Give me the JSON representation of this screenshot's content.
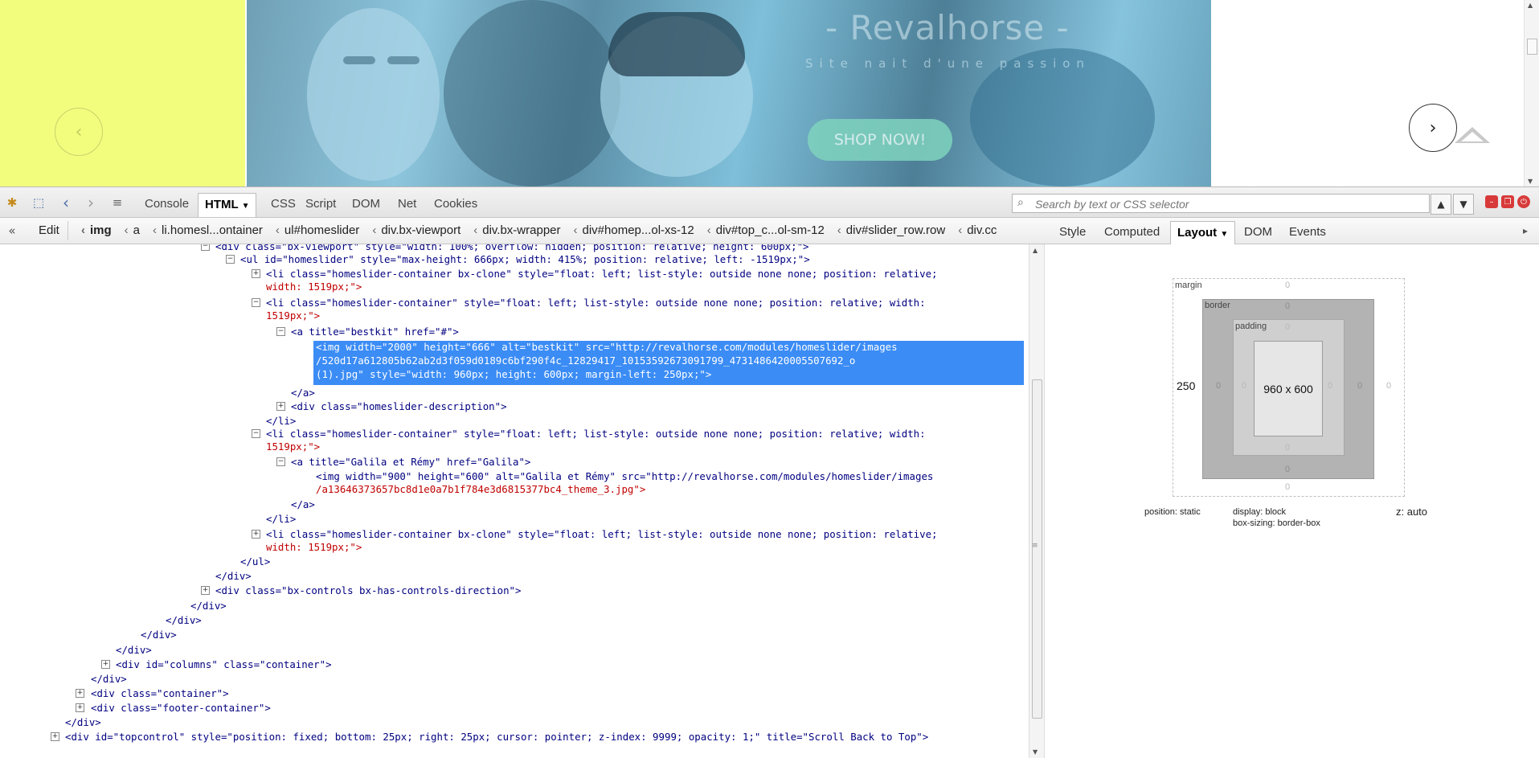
{
  "page": {
    "hero": {
      "title": "- Revalhorse -",
      "subtitle": "Site nait d'une passion",
      "shop_button": "SHOP NOW!"
    },
    "prev_arrow_glyph": "‹",
    "next_arrow_glyph": "›",
    "colors": {
      "yellow_pane": "#f2fd7e",
      "hero_tint": "#7fbfd9",
      "shop_button": "#7fd3be"
    }
  },
  "toolbar": {
    "tabs": [
      "Console",
      "HTML",
      "CSS",
      "Script",
      "DOM",
      "Net",
      "Cookies"
    ],
    "active_tab": "HTML",
    "search_placeholder": "Search by text or CSS selector"
  },
  "breadcrumb": {
    "edit_label": "Edit",
    "items": [
      "img",
      "a",
      "li.homesl...ontainer",
      "ul#homeslider",
      "div.bx-viewport",
      "div.bx-wrapper",
      "div#homep...ol-xs-12",
      "div#top_c...ol-sm-12",
      "div#slider_row.row",
      "div.cc"
    ]
  },
  "side_tabs": [
    "Style",
    "Computed",
    "Layout",
    "DOM",
    "Events"
  ],
  "side_active": "Layout",
  "tree": [
    {
      "t": "<div class=\"bx-viewport\" style=\"width: 100%; overflow: hidden; position: relative; height: 600px;\">"
    },
    {
      "t": "<ul id=\"homeslider\" style=\"max-height: 666px; width: 415%; position: relative; left: -1519px;\">"
    },
    {
      "t": "<li class=\"homeslider-container bx-clone\" style=\"float: left; list-style: outside none none; position: relative;"
    },
    {
      "t": "width: 1519px;\">"
    },
    {
      "t": "<li class=\"homeslider-container\" style=\"float: left; list-style: outside none none; position: relative; width:"
    },
    {
      "t": "1519px;\">"
    },
    {
      "t": "<a title=\"bestkit\" href=\"#\">"
    },
    {
      "t": "<img width=\"2000\" height=\"666\" alt=\"bestkit\" src=\"http://revalhorse.com/modules/homeslider/images"
    },
    {
      "t": "/520d17a612805b62ab2d3f059d0189c6bf290f4c_12829417_10153592673091799_4731486420005507692_o"
    },
    {
      "t": "(1).jpg\" style=\"width: 960px; height: 600px; margin-left: 250px;\">"
    },
    {
      "t": "</a>"
    },
    {
      "t": "<div class=\"homeslider-description\">"
    },
    {
      "t": "</li>"
    },
    {
      "t": "<li class=\"homeslider-container\" style=\"float: left; list-style: outside none none; position: relative; width:"
    },
    {
      "t": "1519px;\">"
    },
    {
      "t": "<a title=\"Galila et Rémy\" href=\"Galila\">"
    },
    {
      "t": "<img width=\"900\" height=\"600\" alt=\"Galila et Rémy\" src=\"http://revalhorse.com/modules/homeslider/images"
    },
    {
      "t": "/a13646373657bc8d1e0a7b1f784e3d6815377bc4_theme_3.jpg\">"
    },
    {
      "t": "</a>"
    },
    {
      "t": "</li>"
    },
    {
      "t": "<li class=\"homeslider-container bx-clone\" style=\"float: left; list-style: outside none none; position: relative;"
    },
    {
      "t": "width: 1519px;\">"
    },
    {
      "t": "</ul>"
    },
    {
      "t": "</div>"
    },
    {
      "t": "<div class=\"bx-controls bx-has-controls-direction\">"
    },
    {
      "t": "</div>"
    },
    {
      "t": "</div>"
    },
    {
      "t": "</div>"
    },
    {
      "t": "</div>"
    },
    {
      "t": "<div id=\"columns\" class=\"container\">"
    },
    {
      "t": "</div>"
    },
    {
      "t": "<div class=\"container\">"
    },
    {
      "t": "<div class=\"footer-container\">"
    },
    {
      "t": "</div>"
    },
    {
      "t": "<div id=\"topcontrol\" style=\"position: fixed; bottom: 25px; right: 25px; cursor: pointer; z-index: 9999; opacity: 1;\" title=\"Scroll Back to Top\">"
    }
  ],
  "box_model": {
    "margin_label": "margin",
    "border_label": "border",
    "padding_label": "padding",
    "content_size": "960 x 600",
    "margin_left": "250",
    "zero": "0",
    "position": "position: static",
    "display": "display: block",
    "box_sizing": "box-sizing: border-box",
    "z_index": "z: auto"
  }
}
